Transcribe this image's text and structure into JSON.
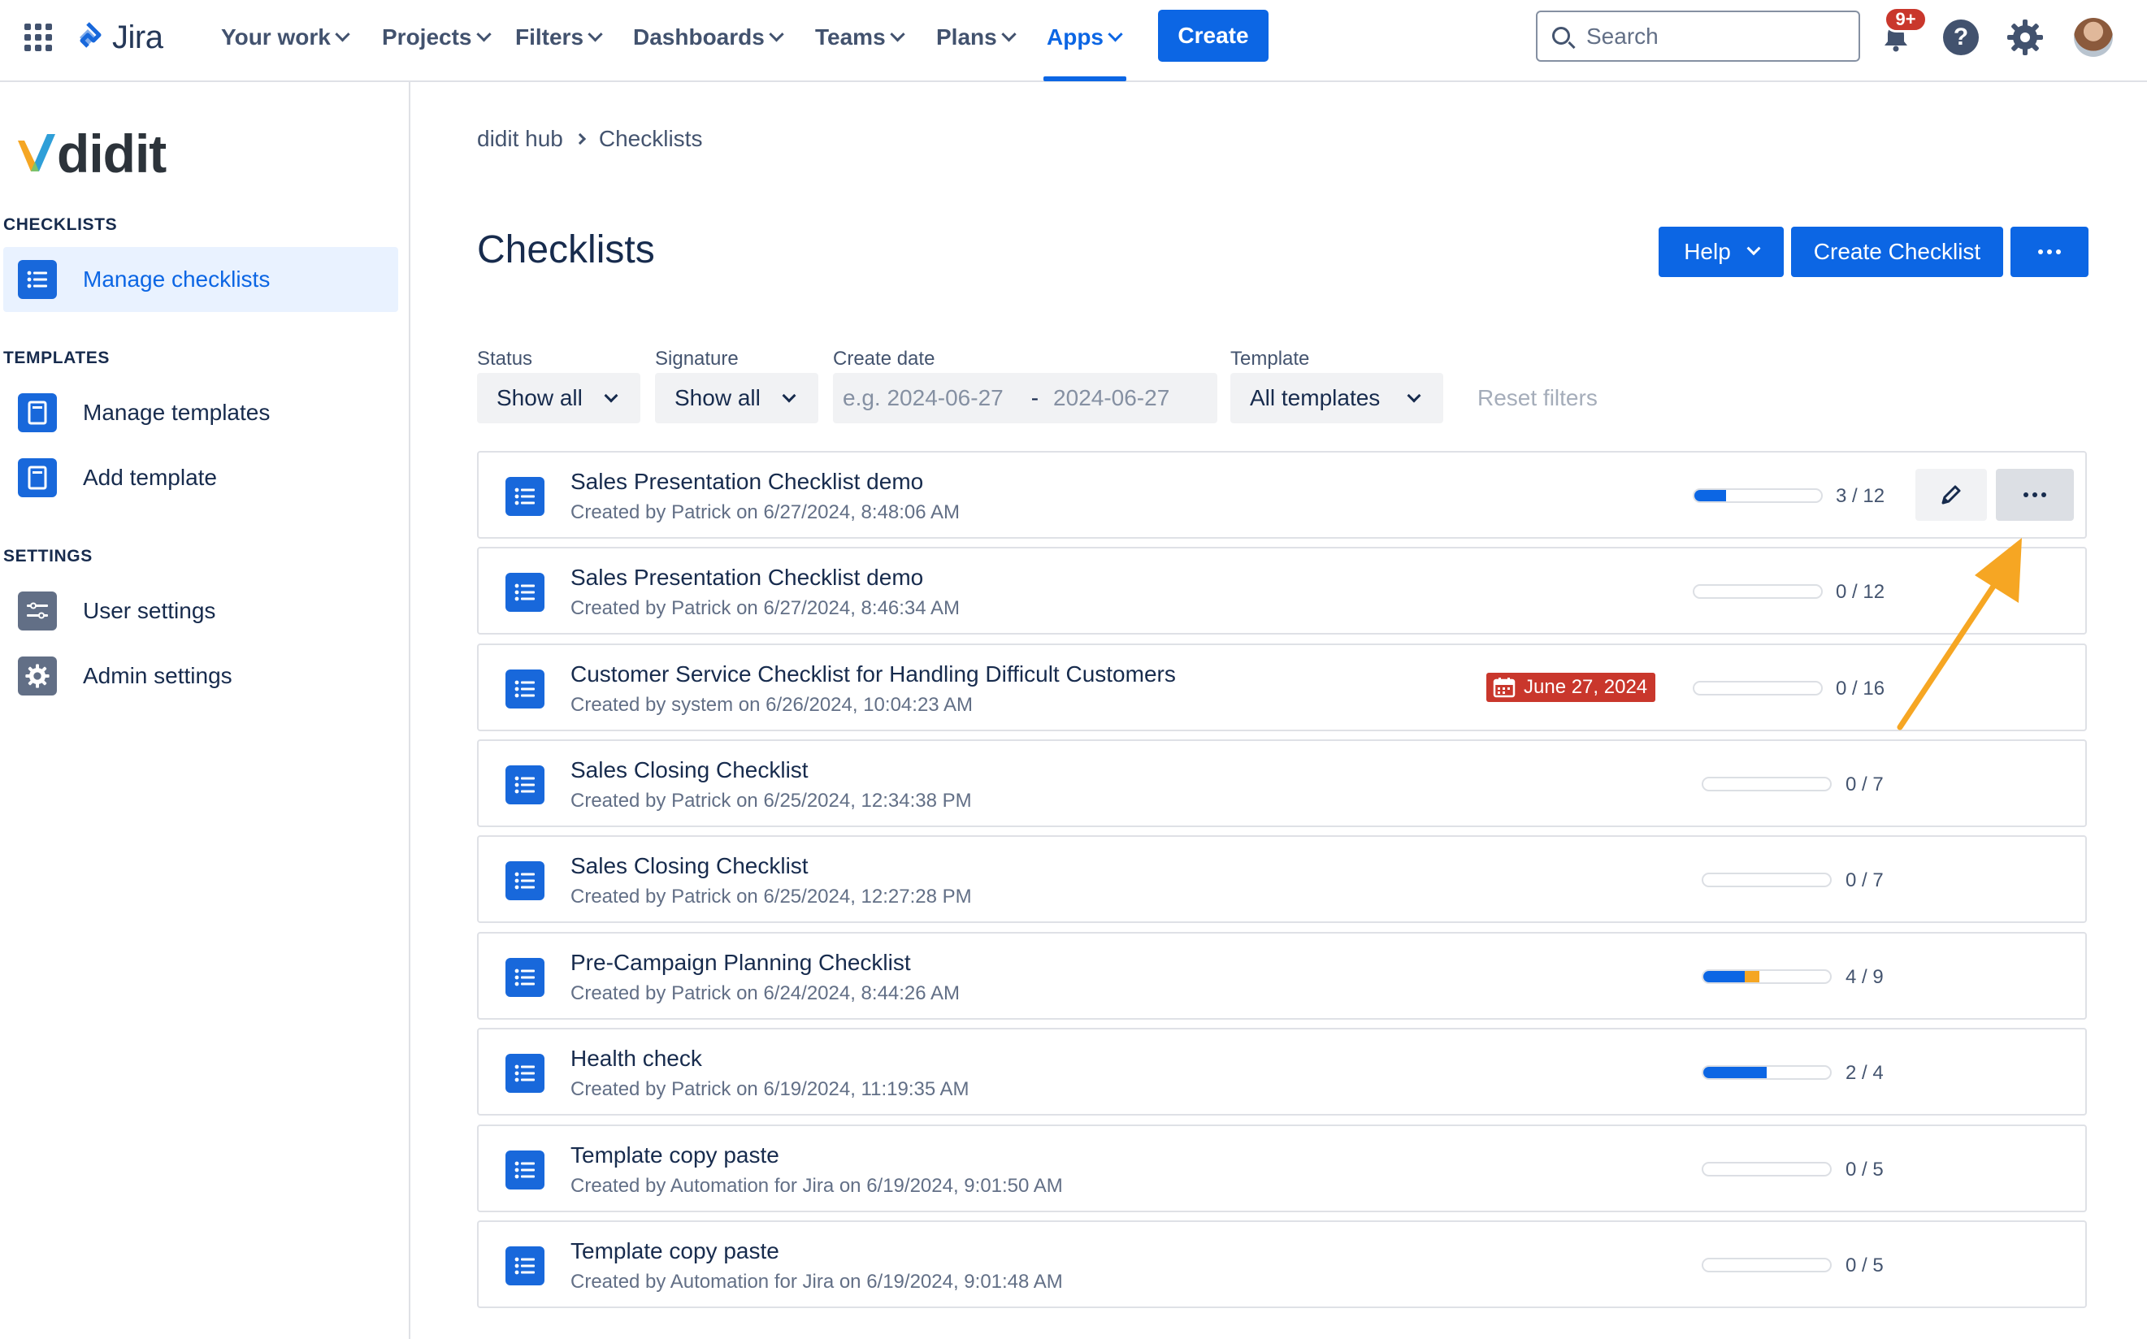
{
  "topnav": {
    "product_name": "Jira",
    "items": [
      {
        "label": "Your work"
      },
      {
        "label": "Projects"
      },
      {
        "label": "Filters"
      },
      {
        "label": "Dashboards"
      },
      {
        "label": "Teams"
      },
      {
        "label": "Plans"
      },
      {
        "label": "Apps",
        "active": true
      }
    ],
    "create_label": "Create",
    "search_placeholder": "Search",
    "notifications_badge": "9+",
    "help_glyph": "?"
  },
  "sidebar": {
    "logo_text": "didit",
    "sections": [
      {
        "title": "CHECKLISTS",
        "items": [
          {
            "label": "Manage checklists",
            "icon": "list-icon",
            "selected": true
          }
        ]
      },
      {
        "title": "TEMPLATES",
        "items": [
          {
            "label": "Manage templates",
            "icon": "template-icon"
          },
          {
            "label": "Add template",
            "icon": "template-icon"
          }
        ]
      },
      {
        "title": "SETTINGS",
        "items": [
          {
            "label": "User settings",
            "icon": "sliders-icon"
          },
          {
            "label": "Admin settings",
            "icon": "gear-icon"
          }
        ]
      }
    ]
  },
  "main": {
    "breadcrumb": [
      "didit hub",
      "Checklists"
    ],
    "title": "Checklists",
    "actions": {
      "help_label": "Help",
      "create_label": "Create Checklist"
    },
    "filters": {
      "status": {
        "label": "Status",
        "value": "Show all"
      },
      "signature": {
        "label": "Signature",
        "value": "Show all"
      },
      "create_date": {
        "label": "Create date",
        "from_placeholder": "e.g. 2024-06-27",
        "separator": "-",
        "to_placeholder": "2024-06-27"
      },
      "template": {
        "label": "Template",
        "value": "All templates"
      },
      "reset_label": "Reset filters"
    },
    "checklists": [
      {
        "title": "Sales Presentation Checklist demo",
        "subtitle": "Created by Patrick on 6/27/2024, 8:48:06 AM",
        "done": 3,
        "total": 12,
        "count": "3 / 12",
        "progress": 0.25,
        "hovered": true
      },
      {
        "title": "Sales Presentation Checklist demo",
        "subtitle": "Created by Patrick on 6/27/2024, 8:46:34 AM",
        "done": 0,
        "total": 12,
        "count": "0 / 12",
        "progress": 0
      },
      {
        "title": "Customer Service Checklist for Handling Difficult Customers",
        "subtitle": "Created by system on 6/26/2024, 10:04:23 AM",
        "done": 0,
        "total": 16,
        "count": "0 / 16",
        "progress": 0,
        "due_date": "June 27, 2024"
      },
      {
        "title": "Sales Closing Checklist",
        "subtitle": "Created by Patrick on 6/25/2024, 12:34:38 PM",
        "done": 0,
        "total": 7,
        "count": "0 / 7",
        "progress": 0
      },
      {
        "title": "Sales Closing Checklist",
        "subtitle": "Created by Patrick on 6/25/2024, 12:27:28 PM",
        "done": 0,
        "total": 7,
        "count": "0 / 7",
        "progress": 0
      },
      {
        "title": "Pre-Campaign Planning Checklist",
        "subtitle": "Created by Patrick on 6/24/2024, 8:44:26 AM",
        "done": 4,
        "total": 9,
        "count": "4 / 9",
        "progress": 0.33,
        "progress_secondary": 0.11
      },
      {
        "title": "Health check",
        "subtitle": "Created by Patrick on 6/19/2024, 11:19:35 AM",
        "done": 2,
        "total": 4,
        "count": "2 / 4",
        "progress": 0.5
      },
      {
        "title": "Template copy paste",
        "subtitle": "Created by Automation for Jira on 6/19/2024, 9:01:50 AM",
        "done": 0,
        "total": 5,
        "count": "0 / 5",
        "progress": 0
      },
      {
        "title": "Template copy paste",
        "subtitle": "Created by Automation for Jira on 6/19/2024, 9:01:48 AM",
        "done": 0,
        "total": 5,
        "count": "0 / 5",
        "progress": 0
      }
    ]
  },
  "colors": {
    "primary": "#0c66e4",
    "secondary_progress": "#f5a623",
    "due_badge": "#c9372c",
    "annotation_arrow": "#f6a623"
  }
}
